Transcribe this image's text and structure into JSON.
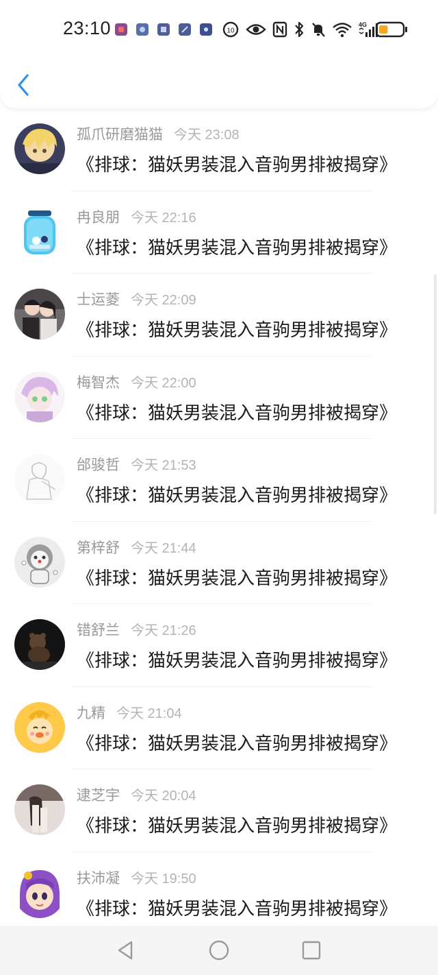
{
  "status_bar": {
    "time": "23:10",
    "network": "4G",
    "battery_level": 0.15,
    "colors": {
      "battery_low": "#f5a623"
    },
    "notification_icons": [
      "app-notification-1",
      "app-notification-2",
      "app-notification-3",
      "app-notification-4",
      "app-notification-5"
    ],
    "system_icons": [
      "data-saver-icon",
      "eye-icon",
      "nfc-icon",
      "bluetooth-icon",
      "mute-icon",
      "wifi-icon",
      "signal-icon",
      "battery-icon"
    ]
  },
  "header": {
    "back_icon": "chevron-left-icon",
    "accent": "#2f8ee8"
  },
  "messages": [
    {
      "name": "孤爪研磨猫猫",
      "time": "今天 23:08",
      "text": "《排球：猫妖男装混入音驹男排被揭穿》"
    },
    {
      "name": "冉良朋",
      "time": "今天 22:16",
      "text": "《排球：猫妖男装混入音驹男排被揭穿》"
    },
    {
      "name": "士运菱",
      "time": "今天 22:09",
      "text": "《排球：猫妖男装混入音驹男排被揭穿》"
    },
    {
      "name": "梅智杰",
      "time": "今天 22:00",
      "text": "《排球：猫妖男装混入音驹男排被揭穿》"
    },
    {
      "name": "邰骏哲",
      "time": "今天 21:53",
      "text": "《排球：猫妖男装混入音驹男排被揭穿》"
    },
    {
      "name": "第梓舒",
      "time": "今天 21:44",
      "text": "《排球：猫妖男装混入音驹男排被揭穿》"
    },
    {
      "name": "错舒兰",
      "time": "今天 21:26",
      "text": "《排球：猫妖男装混入音驹男排被揭穿》"
    },
    {
      "name": "九精",
      "time": "今天 21:04",
      "text": "《排球：猫妖男装混入音驹男排被揭穿》"
    },
    {
      "name": "逮芝宇",
      "time": "今天 20:04",
      "text": "《排球：猫妖男装混入音驹男排被揭穿》"
    },
    {
      "name": "扶沛凝",
      "time": "今天 19:50",
      "text": "《排球：猫妖男装混入音驹男排被揭穿》"
    }
  ],
  "nav_bar": {
    "buttons": [
      "back-triangle-icon",
      "home-circle-icon",
      "recents-square-icon"
    ]
  }
}
